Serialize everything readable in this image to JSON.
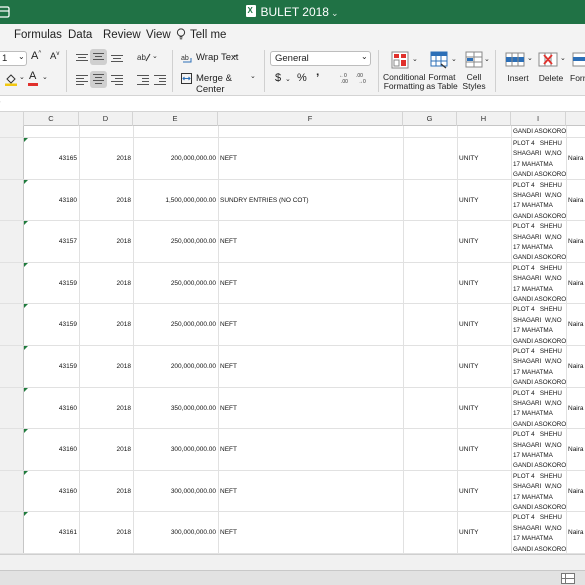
{
  "window": {
    "title": "BULET 2018"
  },
  "tabs": [
    {
      "label": "Formulas"
    },
    {
      "label": "Data"
    },
    {
      "label": "Review"
    },
    {
      "label": "View"
    },
    {
      "label": "Tell me"
    }
  ],
  "ribbon": {
    "font_size": "1",
    "wrap_text": "Wrap Text",
    "merge_center": "Merge & Center",
    "number_format": "General",
    "currency_symbol": "$",
    "percent_symbol": "%",
    "comma_symbol": "’",
    "conditional_formatting": [
      "Conditional",
      "Formatting"
    ],
    "format_as_table": [
      "Format",
      "as Table"
    ],
    "cell_styles": [
      "Cell",
      "Styles"
    ],
    "insert": "Insert",
    "delete": "Delete",
    "format": "Forr",
    "accent_red": "#e0302b",
    "accent_yellow": "#f2c811",
    "accent_blue": "#2c6fb7",
    "brand_green": "#207245"
  },
  "columns": [
    "C",
    "D",
    "E",
    "F",
    "G",
    "H",
    "I"
  ],
  "top_partial": {
    "I": "GANDI ASOKORO"
  },
  "rows": [
    {
      "C": "43165",
      "D": "2018",
      "E": "200,000,000.00",
      "F": "NEFT",
      "H": "UNITY",
      "I": "PLOT 4   SHEHU\nSHAGARI  W,NO\n17 MAHATMA\nGANDI ASOKORO",
      "J": "Naira"
    },
    {
      "C": "43180",
      "D": "2018",
      "E": "1,500,000,000.00",
      "F": "SUNDRY ENTRIES (NO COT)",
      "H": "UNITY",
      "I": "PLOT 4   SHEHU\nSHAGARI  W,NO\n17 MAHATMA\nGANDI ASOKORO",
      "J": "Naira"
    },
    {
      "C": "43157",
      "D": "2018",
      "E": "250,000,000.00",
      "F": "NEFT",
      "H": "UNITY",
      "I": "PLOT 4   SHEHU\nSHAGARI  W,NO\n17 MAHATMA\nGANDI ASOKORO",
      "J": "Naira"
    },
    {
      "C": "43159",
      "D": "2018",
      "E": "250,000,000.00",
      "F": "NEFT",
      "H": "UNITY",
      "I": "PLOT 4   SHEHU\nSHAGARI  W,NO\n17 MAHATMA\nGANDI ASOKORO",
      "J": "Naira"
    },
    {
      "C": "43159",
      "D": "2018",
      "E": "250,000,000.00",
      "F": "NEFT",
      "H": "UNITY",
      "I": "PLOT 4   SHEHU\nSHAGARI  W,NO\n17 MAHATMA\nGANDI ASOKORO",
      "J": "Naira"
    },
    {
      "C": "43159",
      "D": "2018",
      "E": "200,000,000.00",
      "F": "NEFT",
      "H": "UNITY",
      "I": "PLOT 4   SHEHU\nSHAGARI  W,NO\n17 MAHATMA\nGANDI ASOKORO",
      "J": "Naira"
    },
    {
      "C": "43160",
      "D": "2018",
      "E": "350,000,000.00",
      "F": "NEFT",
      "H": "UNITY",
      "I": "PLOT 4   SHEHU\nSHAGARI  W,NO\n17 MAHATMA\nGANDI ASOKORO",
      "J": "Naira"
    },
    {
      "C": "43160",
      "D": "2018",
      "E": "300,000,000.00",
      "F": "NEFT",
      "H": "UNITY",
      "I": "PLOT 4   SHEHU\nSHAGARI  W,NO\n17 MAHATMA\nGANDI ASOKORO",
      "J": "Naira"
    },
    {
      "C": "43160",
      "D": "2018",
      "E": "300,000,000.00",
      "F": "NEFT",
      "H": "UNITY",
      "I": "PLOT 4   SHEHU\nSHAGARI  W,NO\n17 MAHATMA\nGANDI ASOKORO",
      "J": "Naira"
    },
    {
      "C": "43161",
      "D": "2018",
      "E": "300,000,000.00",
      "F": "NEFT",
      "H": "UNITY",
      "I": "PLOT 4   SHEHU\nSHAGARI  W,NO\n17 MAHATMA\nGANDI ASOKORO",
      "J": "Naira"
    }
  ]
}
